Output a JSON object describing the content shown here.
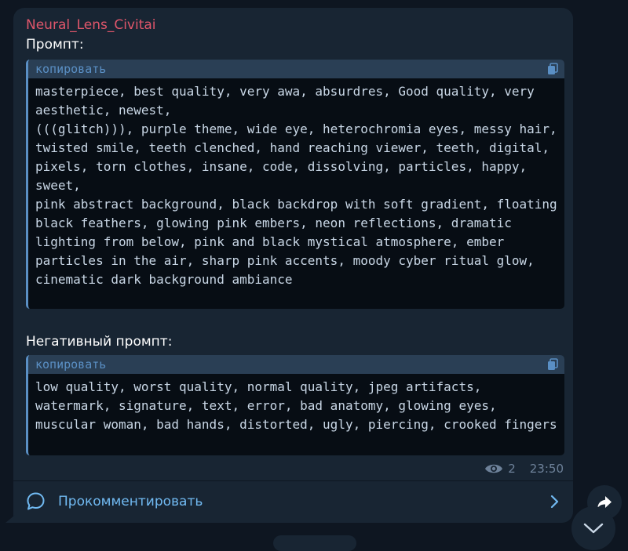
{
  "message": {
    "channel_name": "Neural_Lens_Civitai",
    "prompt_label": "Промпт:",
    "prompt_block": {
      "copy_label": "копировать",
      "text": "masterpiece, best quality, very awa, absurdres, Good quality, very aesthetic, newest,\n(((glitch))), purple theme, wide eye, heterochromia eyes, messy hair, twisted smile, teeth clenched, hand reaching viewer, teeth, digital, pixels, torn clothes, insane, code, dissolving, particles, happy, sweet,\npink abstract background, black backdrop with soft gradient, floating black feathers, glowing pink embers, neon reflections, dramatic lighting from below, pink and black mystical atmosphere, ember particles in the air, sharp pink accents, moody cyber ritual glow, cinematic dark background ambiance"
    },
    "negative_label": "Негативный промпт:",
    "negative_block": {
      "copy_label": "копировать",
      "text": "low quality, worst quality, normal quality, jpeg artifacts, watermark, signature, text, error, bad anatomy, glowing eyes, muscular woman, bad hands, distorted, ugly, piercing, crooked fingers"
    },
    "views": "2",
    "time": "23:50",
    "comment_label": "Прокомментировать"
  },
  "icons": {
    "copy": "copy-icon",
    "views": "eye-icon",
    "comment": "comment-bubble-icon",
    "chevron": "chevron-right-icon",
    "share": "share-arrow-icon",
    "scroll_down": "chevron-down-icon"
  },
  "colors": {
    "background": "#0e1621",
    "bubble": "#182533",
    "channel_name": "#e0566b",
    "code_bg": "#070d14",
    "code_header": "#2a3f55",
    "accent": "#5a8fc4",
    "link": "#71baf2",
    "meta": "#6d8199"
  }
}
